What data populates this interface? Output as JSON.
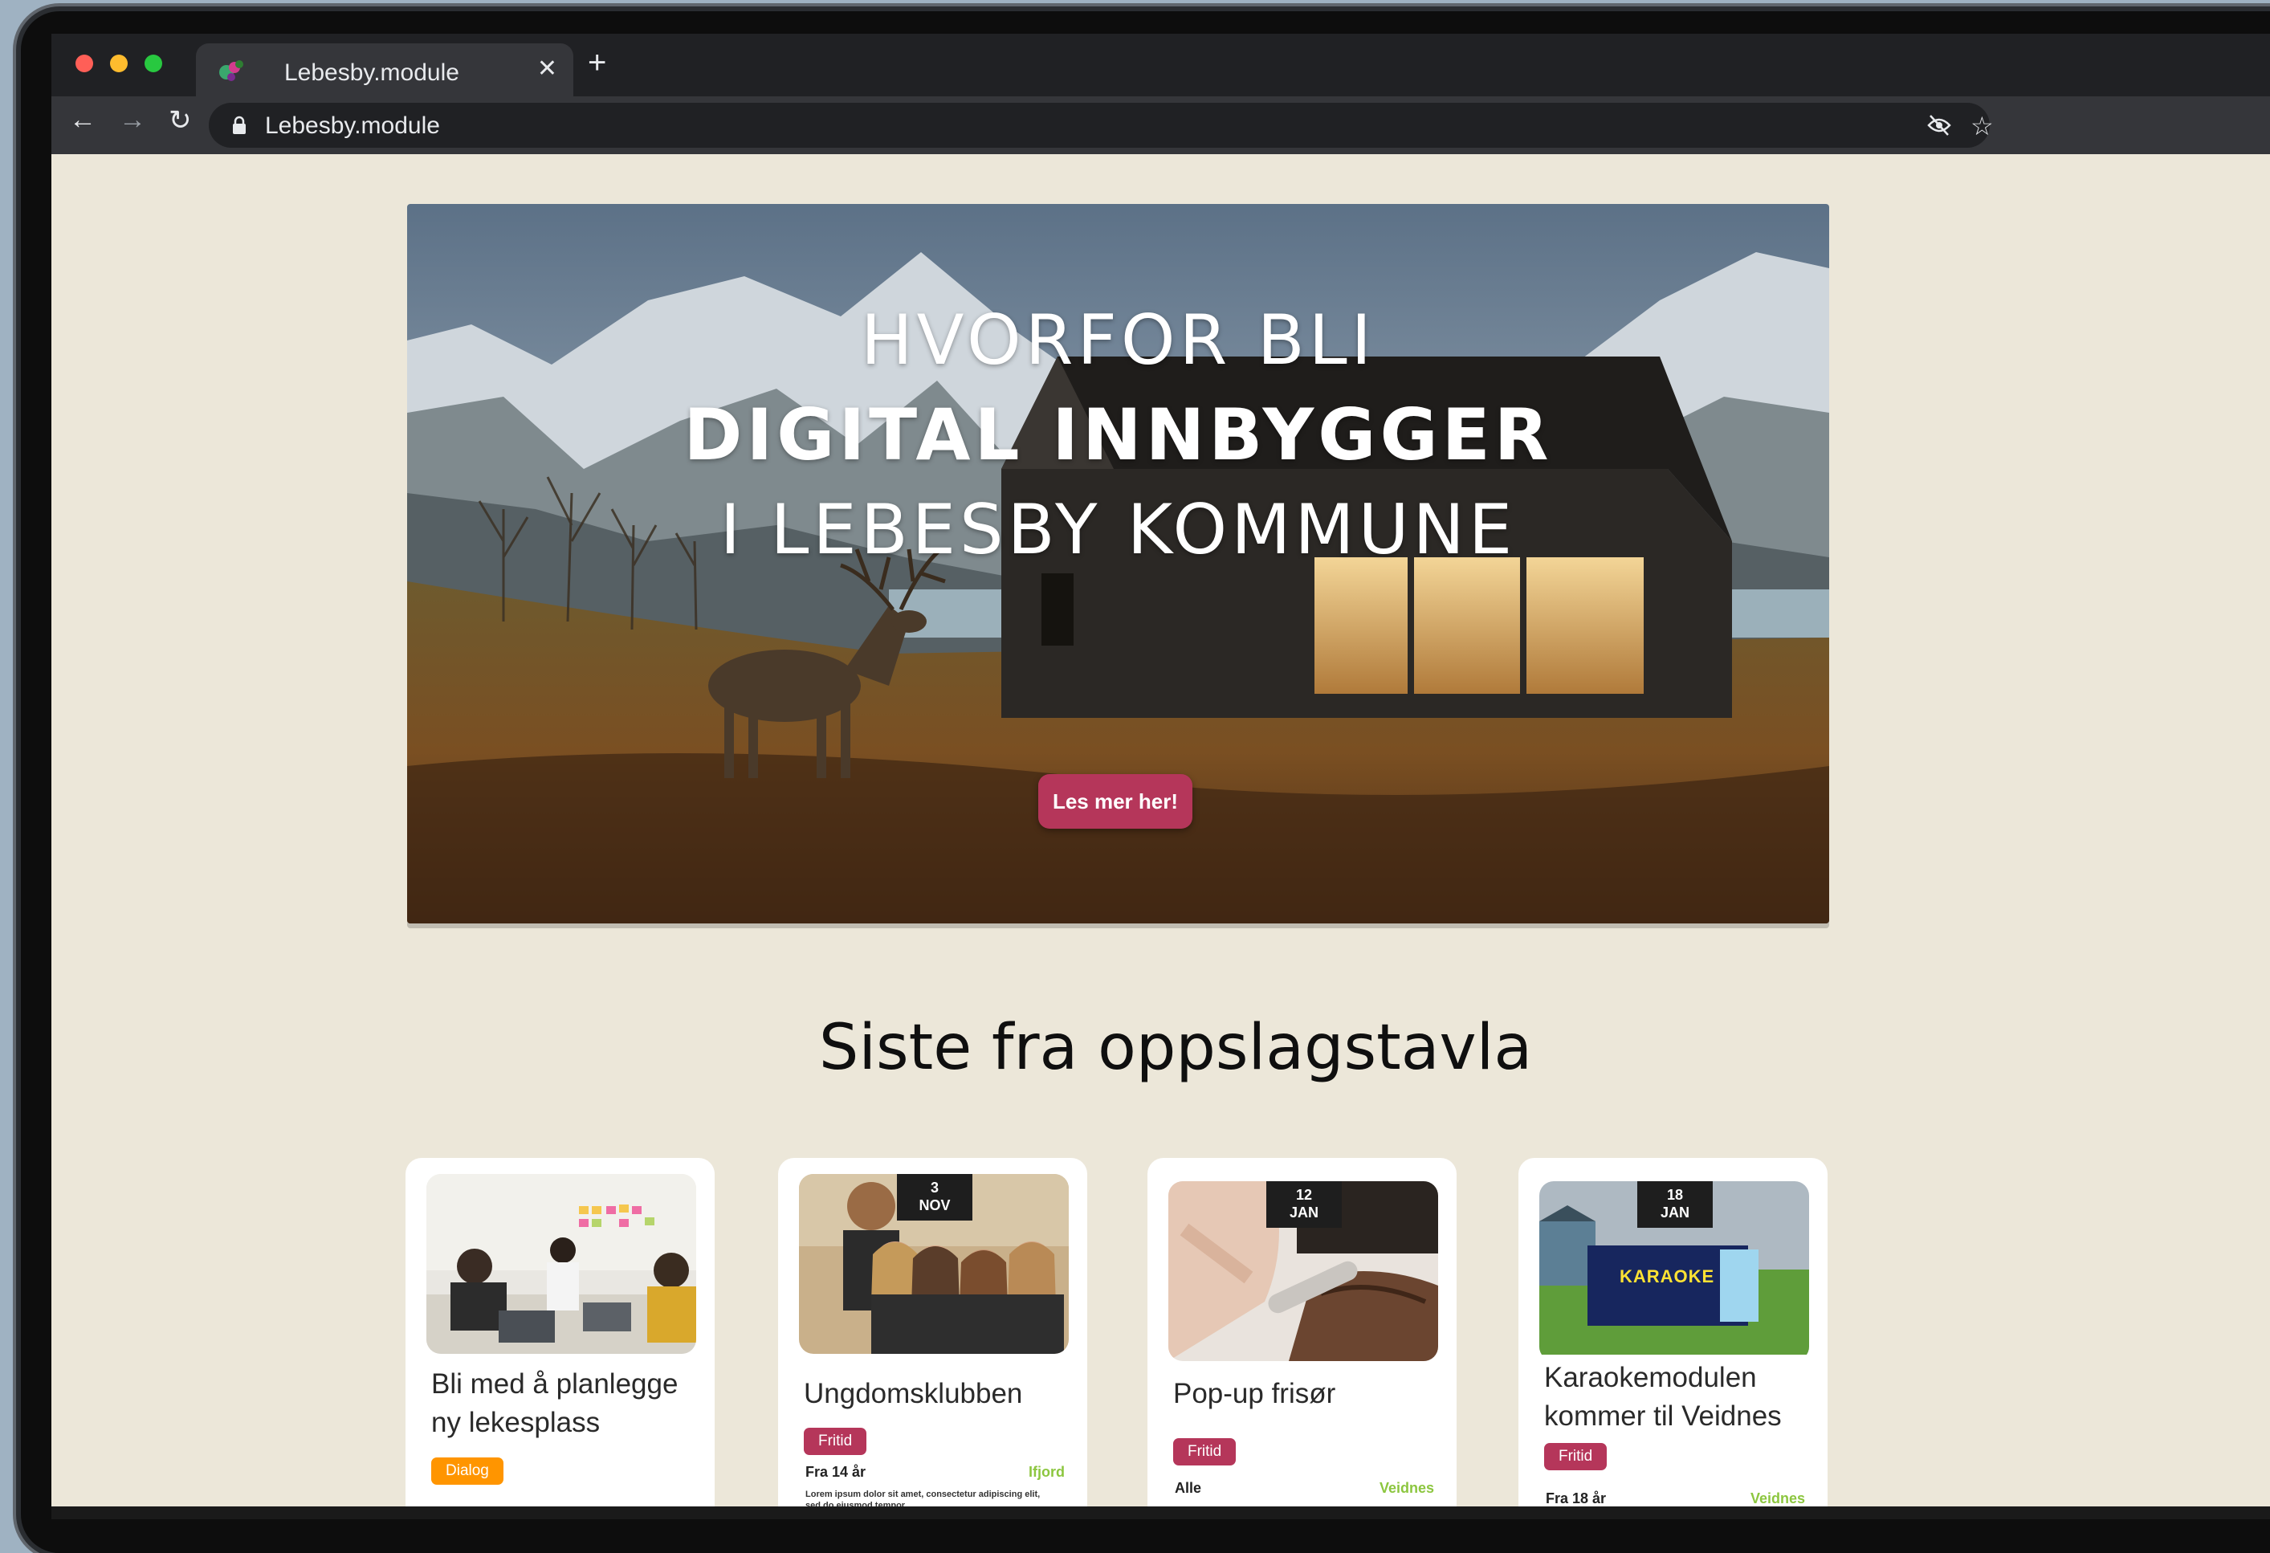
{
  "browser": {
    "tab_title": "Lebesby.module",
    "url": "Lebesby.module",
    "colors": {
      "close": "#ff5f57",
      "minimize": "#febc2e",
      "maximize": "#28c840"
    }
  },
  "hero": {
    "line1": "HVORFOR BLI",
    "line2": "DIGITAL INNBYGGER",
    "line3": "I LEBESBY KOMMUNE",
    "cta": "Les mer her!"
  },
  "section": {
    "title": "Siste fra oppslagstavla"
  },
  "cards": [
    {
      "title": "Bli med å planlegge ny lekesplass",
      "tag": "Dialog",
      "tag_color": "#ff9500"
    },
    {
      "title": "Ungdomsklubben",
      "day": "3",
      "month": "NOV",
      "tag": "Fritid",
      "tag_color": "#b5365a",
      "audience": "Fra 14 år",
      "place": "Ifjord",
      "excerpt": "Lorem ipsum dolor sit amet, consectetur adipiscing elit, sed do eiusmod tempor"
    },
    {
      "title": "Pop-up frisør",
      "day": "12",
      "month": "JAN",
      "tag": "Fritid",
      "tag_color": "#b5365a",
      "audience": "Alle",
      "place": "Veidnes"
    },
    {
      "title": "Karaokemodulen kommer til Veidnes",
      "day": "18",
      "month": "JAN",
      "tag": "Fritid",
      "tag_color": "#b5365a",
      "audience": "Fra 18 år",
      "place": "Veidnes",
      "image_sign": "KARAOKE"
    }
  ]
}
